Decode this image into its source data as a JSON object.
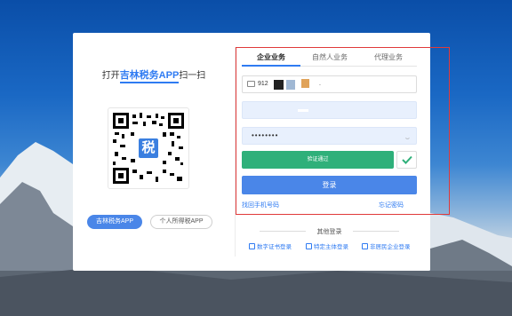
{
  "left": {
    "scan_prefix": "打开",
    "scan_brand": "吉林税务APP",
    "scan_suffix": "扫一扫",
    "qr_logo_char": "税",
    "app_buttons": [
      "吉林税务APP",
      "个人所得税APP"
    ]
  },
  "tabs": [
    "企业业务",
    "自然人业务",
    "代理业务"
  ],
  "form": {
    "account_value": "912",
    "account_tail": ".",
    "password_mask": "••••••••",
    "verify_label": "验证通过",
    "login_label": "登录"
  },
  "links": {
    "find_phone": "找回手机号码",
    "forgot_password": "忘记密码"
  },
  "other": {
    "title": "其他登录",
    "options": [
      "数字证书登录",
      "特定主体登录",
      "非居民企业登录"
    ]
  },
  "colors": {
    "accent": "#4a86e8",
    "verify": "#2fb07a",
    "highlight": "#e03a3a"
  }
}
